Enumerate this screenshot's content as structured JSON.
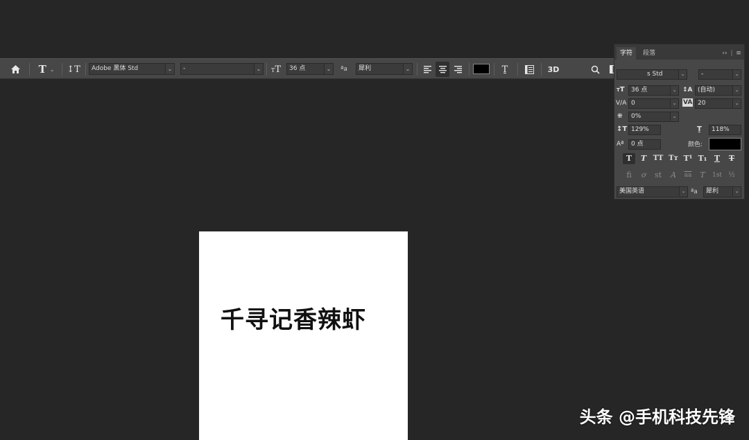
{
  "options_bar": {
    "font_family": "Adobe 黑体 Std",
    "font_style": "-",
    "font_size": "36 点",
    "anti_alias_icon_text": "ªa",
    "anti_alias": "犀利",
    "label_3d": "3D",
    "text_color": "#000000",
    "icons": [
      "home-icon",
      "type-tool-icon",
      "text-orientation-icon",
      "font-size-icon",
      "align-left-icon",
      "align-center-icon",
      "align-right-icon",
      "warp-text-icon",
      "character-panel-toggle-icon",
      "search-icon",
      "workspace-icon",
      "share-icon"
    ]
  },
  "character_panel": {
    "tabs": [
      "字符",
      "段落"
    ],
    "font_family_partial": "s Std",
    "font_style": "-",
    "font_size": "36 点",
    "leading": "(自动)",
    "kerning": "0",
    "tracking": "20",
    "tsume": "0%",
    "vertical_scale": "129%",
    "horizontal_scale": "118%",
    "baseline_shift": "0 点",
    "color_label": "颜色:",
    "color": "#000000",
    "language": "美国英语",
    "anti_alias_icon_text": "ªa",
    "anti_alias": "犀利",
    "style_buttons": [
      "T",
      "T",
      "TT",
      "Tт",
      "T¹",
      "T₁",
      "T",
      "T"
    ],
    "opentype_buttons": [
      "fi",
      "ơ",
      "st",
      "A",
      "aa",
      "T",
      "1st",
      "½"
    ]
  },
  "document": {
    "text": "千寻记香辣虾",
    "background": "#ffffff"
  },
  "watermark": "头条 @手机科技先锋"
}
